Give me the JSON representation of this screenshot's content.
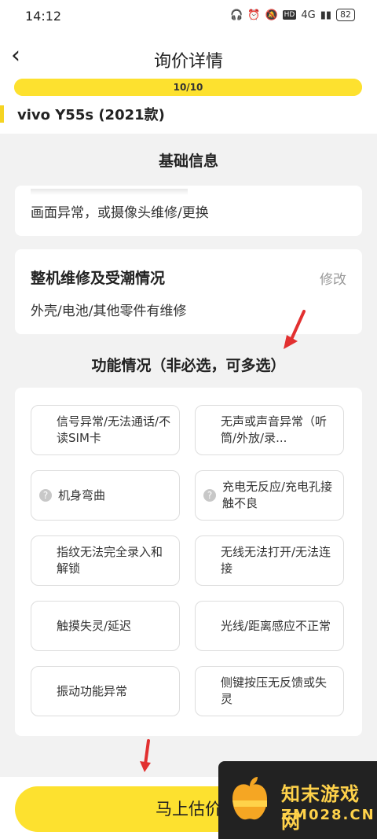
{
  "status": {
    "time": "14:12",
    "hd": "HD",
    "network": "4G",
    "battery": "82"
  },
  "header": {
    "title": "询价详情",
    "progress_text": "10/10",
    "progress": 1.0,
    "model": "vivo Y55s (2021款)"
  },
  "basic": {
    "section_title": "基础信息",
    "screen_value": "画面异常，或摄像头维修/更换",
    "repair_title": "整机维修及受潮情况",
    "repair_modify": "修改",
    "repair_value": "外壳/电池/其他零件有维修"
  },
  "function": {
    "section_title": "功能情况（非必选，可多选）",
    "options": [
      "信号异常/无法通话/不读SIM卡",
      "无声或声音异常（听筒/外放/录...",
      "机身弯曲",
      "充电无反应/充电孔接触不良",
      "指纹无法完全录入和解锁",
      "无线无法打开/无法连接",
      "触摸失灵/延迟",
      "光线/距离感应不正常",
      "振动功能异常",
      "侧键按压无反馈或失灵"
    ]
  },
  "cta": {
    "label": "马上估价"
  },
  "watermark": {
    "line1": "知末游戏网",
    "line2": "ZM028.CN"
  },
  "colors": {
    "accent": "#fde12f",
    "arrow": "#e23030"
  }
}
